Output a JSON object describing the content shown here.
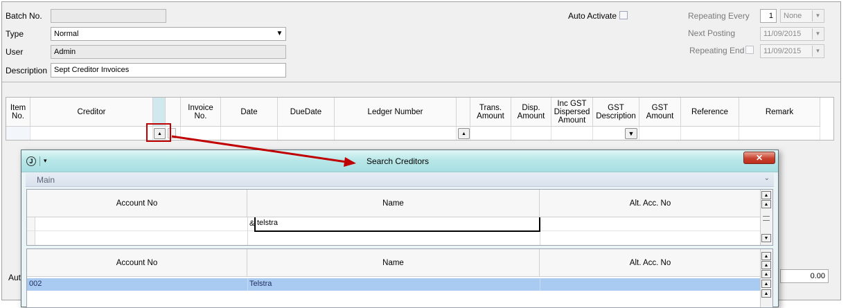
{
  "header": {
    "batch_no_label": "Batch No.",
    "batch_no_value": "",
    "type_label": "Type",
    "type_value": "Normal",
    "user_label": "User",
    "user_value": "Admin",
    "description_label": "Description",
    "description_value": "Sept Creditor Invoices",
    "auto_activate_label": "Auto Activate",
    "repeating_every_label": "Repeating Every",
    "repeating_every_value": "1",
    "repeating_every_unit": "None",
    "next_posting_label": "Next Posting",
    "next_posting_value": "11/09/2015",
    "repeating_end_label": "Repeating End",
    "repeating_end_value": "11/09/2015"
  },
  "grid": {
    "columns": [
      "Item No.",
      "Creditor",
      "",
      "",
      "Invoice No.",
      "Date",
      "DueDate",
      "Ledger Number",
      "",
      "Trans. Amount",
      "Disp. Amount",
      "Inc GST Dispersed Amount",
      "GST Description",
      "GST Amount",
      "Reference",
      "Remark"
    ]
  },
  "footer": {
    "left_label_partial": "Aut",
    "total_value": "0.00"
  },
  "popup": {
    "title": "Search Creditors",
    "app_icon": "J",
    "section_label": "Main",
    "filter_columns": [
      "Account No",
      "Name",
      "Alt. Acc. No"
    ],
    "filter_prefix": "&",
    "filter_name_value": "telstra",
    "results_columns": [
      "Account No",
      "Name",
      "Alt. Acc. No"
    ],
    "results": [
      {
        "account_no": "002",
        "name": "Telstra",
        "alt_acc_no": ""
      }
    ]
  },
  "colors": {
    "annotation_red": "#c00000",
    "selected_row": "#aacbf1",
    "title_bar": "#b9e7e8"
  }
}
